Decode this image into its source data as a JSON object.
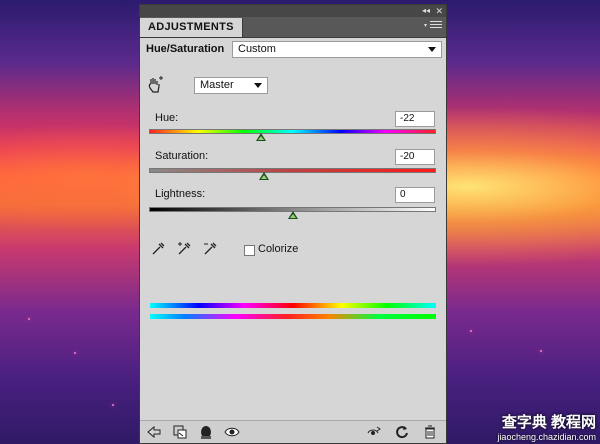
{
  "panel": {
    "tab_label": "ADJUSTMENTS",
    "collapse_glyph": "◂◂",
    "close_glyph": "✕",
    "title": "Hue/Saturation",
    "preset_value": "Custom",
    "channel_value": "Master"
  },
  "sliders": {
    "hue": {
      "label": "Hue:",
      "value": "-22",
      "fraction": 0.39
    },
    "saturation": {
      "label": "Saturation:",
      "value": "-20",
      "fraction": 0.4
    },
    "lightness": {
      "label": "Lightness:",
      "value": "0",
      "fraction": 0.5
    }
  },
  "colorize": {
    "label": "Colorize",
    "checked": false
  },
  "icons": {
    "targeted_adjust": "hand-targeted-adjust-icon",
    "eyedropper": "eyedropper-icon",
    "eyedropper_add": "eyedropper-add-icon",
    "eyedropper_subtract": "eyedropper-subtract-icon",
    "back": "back-arrow-icon",
    "clip": "clip-to-layer-icon",
    "mask": "layer-mask-icon",
    "visibility": "eye-icon",
    "previous_state": "view-previous-icon",
    "reset": "reset-icon",
    "delete": "trash-icon"
  },
  "watermark": {
    "main": "查字典 教程网",
    "sub": "jiaocheng.chazidian.com"
  },
  "colors": {
    "panel_bg": "#d6d6d6",
    "thumb": "#1a4f1a"
  }
}
